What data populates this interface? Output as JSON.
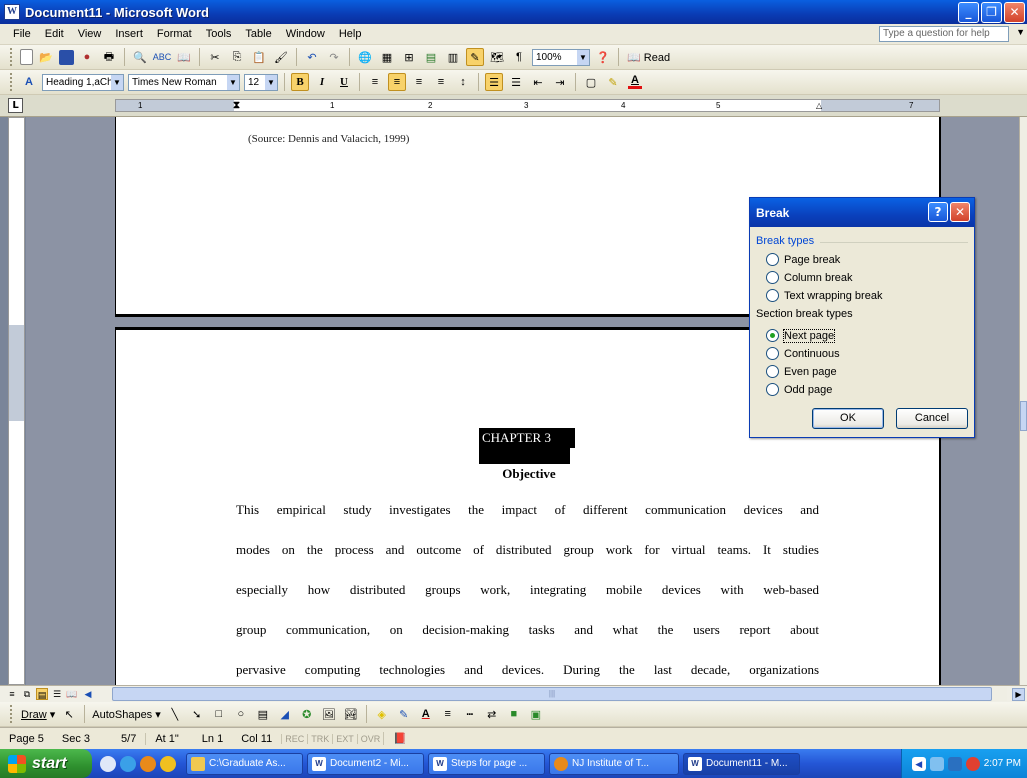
{
  "window": {
    "title": "Document11 - Microsoft Word"
  },
  "menu": {
    "items": [
      "File",
      "Edit",
      "View",
      "Insert",
      "Format",
      "Tools",
      "Table",
      "Window",
      "Help"
    ],
    "help_placeholder": "Type a question for help"
  },
  "standard_toolbar": {
    "zoom": "100%",
    "read_label": "Read"
  },
  "formatting_toolbar": {
    "style": "Heading 1,aCh",
    "font": "Times New Roman",
    "size": "12",
    "bold": "B",
    "italic": "I",
    "underline": "U",
    "font_color_letter": "A"
  },
  "ruler": {
    "numbers": [
      "1",
      "1",
      "2",
      "3",
      "4",
      "5",
      "7"
    ]
  },
  "document": {
    "source_line": "(Source: Dennis and Valacich, 1999)",
    "chapter": "CHAPTER 3",
    "objective": "Objective",
    "body_lines": [
      "This empirical study investigates the impact of different communication devices and",
      "modes on the process and outcome of distributed group work for virtual teams. It studies",
      "especially how distributed groups work, integrating mobile devices with web-based",
      "group communication, on decision-making tasks and what the users report about",
      "pervasive computing technologies and devices. During the last decade, organizations"
    ]
  },
  "draw_toolbar": {
    "draw": "Draw",
    "autoshapes": "AutoShapes"
  },
  "status": {
    "page": "Page 5",
    "sec": "Sec 3",
    "pages": "5/7",
    "at": "At 1\"",
    "ln": "Ln 1",
    "col": "Col 11",
    "modes": [
      "REC",
      "TRK",
      "EXT",
      "OVR"
    ]
  },
  "taskbar": {
    "start": "start",
    "tasks": [
      "C:\\Graduate As...",
      "Document2 - Mi...",
      "Steps for page ...",
      "NJ Institute of T...",
      "Document11 - M..."
    ],
    "clock": "2:07 PM"
  },
  "dialog": {
    "title": "Break",
    "help_btn": "?",
    "break_types_label": "Break types",
    "break_options": [
      "Page break",
      "Column break",
      "Text wrapping break"
    ],
    "section_label": "Section break types",
    "section_options": [
      "Next page",
      "Continuous",
      "Even page",
      "Odd page"
    ],
    "selected_section": "Next page",
    "ok": "OK",
    "cancel": "Cancel"
  },
  "colors": {
    "title_bar": "#0a3cb4",
    "dialog_group_label": "#0046d5",
    "radio_checked": "#21a121"
  }
}
